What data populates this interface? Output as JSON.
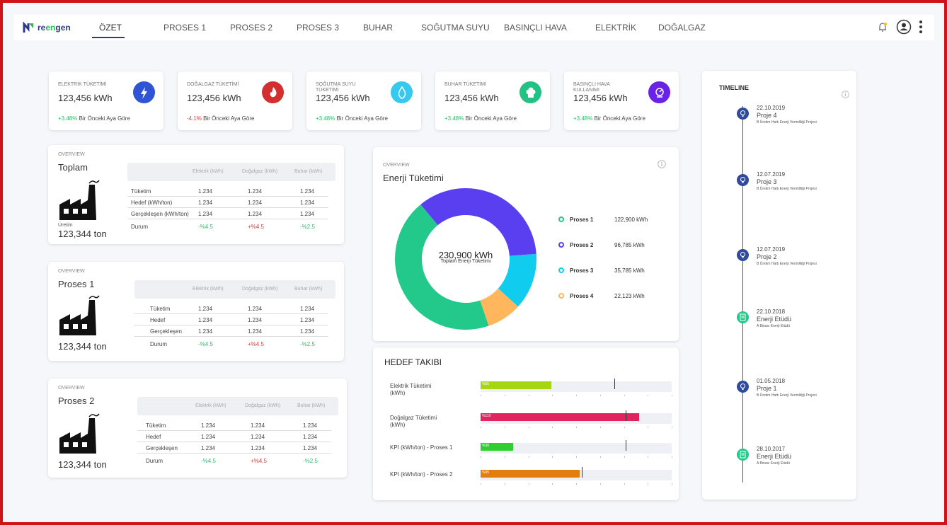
{
  "brand": {
    "pre": "re",
    "mid": "en",
    "post": "gen",
    "g_pre": "g"
  },
  "nav": {
    "tabs": [
      "ÖZET",
      "PROSES 1",
      "PROSES 2",
      "PROSES 3",
      "BUHAR",
      "SOĞUTMA SUYU",
      "BASINÇLI HAVA",
      "ELEKTRİK",
      "DOĞALGAZ"
    ],
    "active": "ÖZET"
  },
  "kpis": [
    {
      "title": "ELEKTRİK TÜKETİMİ",
      "value": "123,456 kWh",
      "change": "+3.48%",
      "change_dir": "up",
      "note": "Bir Önceki Aya Göre",
      "icon": "lightning-icon",
      "color": "#2f55d4"
    },
    {
      "title": "DOĞALGAZ TÜKETİMİ",
      "value": "123,456 kWh",
      "change": "-4.1%",
      "change_dir": "down",
      "note": "Bir Önceki Aya Göre",
      "icon": "flame-icon",
      "color": "#d32f2f"
    },
    {
      "title": "SOĞUTMA SUYU TÜKETİMİ",
      "value": "123,456 kWh",
      "change": "+3.48%",
      "change_dir": "up",
      "note": "Bir Önceki Aya Göre",
      "icon": "water-drop-icon",
      "color": "#37c8f0"
    },
    {
      "title": "BUHAR TÜKETİMİ",
      "value": "123,456 kWh",
      "change": "+3.48%",
      "change_dir": "up",
      "note": "Bir Önceki Aya Göre",
      "icon": "steam-icon",
      "color": "#22c285"
    },
    {
      "title": "BASINÇLI HAVA KULLANIMI",
      "value": "123,456 kWh",
      "change": "+3.48%",
      "change_dir": "up",
      "note": "Bir Önceki Aya Göre",
      "icon": "gauge-icon",
      "color": "#6a22e6"
    }
  ],
  "overview_label": "OVERVIEW",
  "cols": [
    "Elektrik (kWh)",
    "Doğalgaz (kWh)",
    "Buhar (kWh)"
  ],
  "toplam": {
    "title": "Toplam",
    "prod_label": "Üretim",
    "prod_value": "123,344 ton",
    "rows": [
      [
        "Tüketim",
        "1.234",
        "1.234",
        "1.234"
      ],
      [
        "Hedef (kWh/ton)",
        "1.234",
        "1.234",
        "1.234"
      ],
      [
        "Gerçekleşen (kWh/ton)",
        "1.234",
        "1.234",
        "1.234"
      ],
      [
        "Durum",
        "-%4.5",
        "+%4.5",
        "-%2.5"
      ]
    ]
  },
  "proses1": {
    "title": "Proses 1",
    "prod_value": "123,344 ton",
    "rows": [
      [
        "Tüketim",
        "1.234",
        "1.234",
        "1.234"
      ],
      [
        "Hedef",
        "1.234",
        "1.234",
        "1.234"
      ],
      [
        "Gerçekleşen",
        "1.234",
        "1.234",
        "1.234"
      ],
      [
        "Durum",
        "-%4.5",
        "+%4.5",
        "-%2.5"
      ]
    ]
  },
  "proses2": {
    "title": "Proses 2",
    "prod_value": "123,344 ton",
    "rows": [
      [
        "Tüketim",
        "1.234",
        "1.234",
        "1.234"
      ],
      [
        "Hedef",
        "1.234",
        "1.234",
        "1.234"
      ],
      [
        "Gerçekleşen",
        "1.234",
        "1.234",
        "1.234"
      ],
      [
        "Durum",
        "-%4.5",
        "+%4.5",
        "-%2.5"
      ]
    ]
  },
  "energy": {
    "title": "Enerji Tüketimi",
    "center_value": "230,900 kWh",
    "center_label": "Toplam Enerji Tüketimi"
  },
  "chart_data": {
    "type": "pie",
    "title": "Enerji Tüketimi",
    "categories": [
      "Proses 1",
      "Proses 2",
      "Proses 3",
      "Proses 4"
    ],
    "values": [
      122900,
      96785,
      35785,
      22123
    ],
    "value_labels": [
      "122,900 kWh",
      "96,785 kWh",
      "35,785 kWh",
      "22,123 kWh"
    ],
    "colors": [
      "#22c98a",
      "#5a3ff0",
      "#10cdf0",
      "#ffb65c"
    ]
  },
  "goals": {
    "title": "HEDEF TAKIBI",
    "items": [
      {
        "label": "Elektrik Tüketimi (kWh)",
        "pct_text": "%65",
        "fill": 0.37,
        "target": 0.7,
        "color": "#a5d610"
      },
      {
        "label": "Doğalgaz Tüketimi (kWh)",
        "pct_text": "%110",
        "fill": 0.83,
        "target": 0.76,
        "color": "#e0245e"
      },
      {
        "label": "KPI (kWh/ton) - Proses 1",
        "pct_text": "%30",
        "fill": 0.17,
        "target": 0.76,
        "color": "#2fcf2f"
      },
      {
        "label": "KPI (kWh/ton) - Proses 2",
        "pct_text": "%95",
        "fill": 0.52,
        "target": 0.53,
        "color": "#e07f10"
      }
    ]
  },
  "timeline": {
    "title": "TIMELINE",
    "items": [
      {
        "date": "22.10.2019",
        "name": "Proje 4",
        "desc": "B Üretim Hattı Enerji Verimliliği Projesi",
        "type": "bulb",
        "color": "#2f4a9e"
      },
      {
        "date": "12.07.2019",
        "name": "Proje 3",
        "desc": "B Üretim Hattı Enerji Verimliliği Projesi",
        "type": "bulb",
        "color": "#2f4a9e"
      },
      {
        "date": "12.07.2019",
        "name": "Proje 2",
        "desc": "B Üretim Hattı Enerji Verimliliği Projesi",
        "type": "bulb",
        "color": "#2f4a9e"
      },
      {
        "date": "22.10.2018",
        "name": "Enerji Etüdü",
        "desc": "A Binası Enerji Etüdü",
        "type": "doc",
        "color": "#22c98a"
      },
      {
        "date": "01.05.2018",
        "name": "Proje 1",
        "desc": "B Üretim Hattı Enerji Verimliliği Projesi",
        "type": "bulb",
        "color": "#2f4a9e"
      },
      {
        "date": "28.10.2017",
        "name": "Enerji Etüdü",
        "desc": "A Binası Enerji Etüdü",
        "type": "doc",
        "color": "#22c98a"
      }
    ]
  }
}
